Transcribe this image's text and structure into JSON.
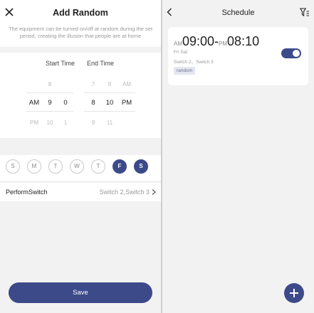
{
  "left": {
    "title": "Add Random",
    "description": "The equipment can be turned on/off at random during the set period, creating the illusion that people are at home",
    "start_header": "Start Time",
    "end_header": "End Time",
    "picker": {
      "start_ampm": [
        "",
        "AM",
        "PM"
      ],
      "start_hour": [
        "8",
        "9",
        "10"
      ],
      "start_min": [
        "",
        "0",
        "1"
      ],
      "end_hour": [
        "7",
        "8",
        "9"
      ],
      "end_min": [
        "9",
        "10",
        "11"
      ],
      "end_ampm": [
        "AM",
        "PM",
        ""
      ]
    },
    "days": [
      {
        "label": "S",
        "selected": false
      },
      {
        "label": "M",
        "selected": false
      },
      {
        "label": "T",
        "selected": false
      },
      {
        "label": "W",
        "selected": false
      },
      {
        "label": "T",
        "selected": false
      },
      {
        "label": "F",
        "selected": true
      },
      {
        "label": "S",
        "selected": true
      }
    ],
    "perform_label": "PerformSwitch",
    "perform_value": "Switch 2,Switch 3",
    "save_label": "Save"
  },
  "right": {
    "title": "Schedule",
    "card": {
      "start_ampm": "AM",
      "start_time": "09:00",
      "separator": "-",
      "end_ampm": "PM",
      "end_time": "08:10",
      "days": "Fri Sat",
      "switches": "Switch 2、Switch 3",
      "tag": "random",
      "enabled": true
    }
  },
  "colors": {
    "accent": "#3c4a8a",
    "background": "#f2f2f2"
  },
  "icons": [
    "close-icon",
    "chevron-right-icon",
    "back-icon",
    "filter-icon",
    "plus-icon"
  ]
}
